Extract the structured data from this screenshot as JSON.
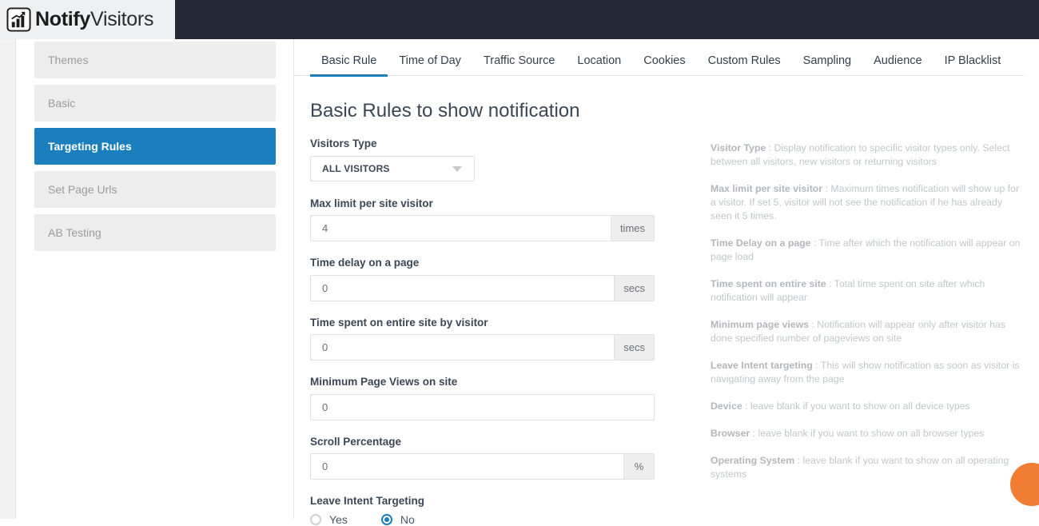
{
  "brand": {
    "logo_icon": "bar-chart-growth-icon",
    "name_bold": "Notify",
    "name_light": "Visitors"
  },
  "sidebar": {
    "items": [
      {
        "label": "Themes",
        "active": false
      },
      {
        "label": "Basic",
        "active": false
      },
      {
        "label": "Targeting Rules",
        "active": true
      },
      {
        "label": "Set Page Urls",
        "active": false
      },
      {
        "label": "AB Testing",
        "active": false
      }
    ]
  },
  "tabs": [
    {
      "label": "Basic Rule",
      "active": true
    },
    {
      "label": "Time of Day",
      "active": false
    },
    {
      "label": "Traffic Source",
      "active": false
    },
    {
      "label": "Location",
      "active": false
    },
    {
      "label": "Cookies",
      "active": false
    },
    {
      "label": "Custom Rules",
      "active": false
    },
    {
      "label": "Sampling",
      "active": false
    },
    {
      "label": "Audience",
      "active": false
    },
    {
      "label": "IP Blacklist",
      "active": false
    }
  ],
  "main": {
    "title": "Basic Rules to show notification",
    "visitors_type": {
      "label": "Visitors Type",
      "value": "ALL VISITORS",
      "caret_icon": "chevron-down-icon"
    },
    "max_limit": {
      "label": "Max limit per site visitor",
      "value": "4",
      "placeholder": "4",
      "suffix": "times"
    },
    "time_delay": {
      "label": "Time delay on a page",
      "value": "0",
      "placeholder": "0",
      "suffix": "secs"
    },
    "time_spent": {
      "label": "Time spent on entire site by visitor",
      "value": "0",
      "placeholder": "0",
      "suffix": "secs"
    },
    "min_page_views": {
      "label": "Minimum Page Views on site",
      "value": "0",
      "placeholder": "0"
    },
    "scroll_percentage": {
      "label": "Scroll Percentage",
      "value": "0",
      "placeholder": "0",
      "suffix": "%"
    },
    "leave_intent": {
      "label": "Leave Intent Targeting",
      "yes_label": "Yes",
      "no_label": "No",
      "selected": "No"
    }
  },
  "help": {
    "items": [
      {
        "term": "Visitor Type",
        "text": " : Display notification to specific visitor types only. Select between all visitors, new visitors or returning visitors"
      },
      {
        "term": "Max limit per site visitor",
        "text": " : Maximum times notification will show up for a visitor. If set 5, visitor will not see the notification if he has already seen it 5 times."
      },
      {
        "term": "Time Delay on a page",
        "text": " : Time after which the notification will appear on page load"
      },
      {
        "term": "Time spent on entire site",
        "text": " : Total time spent on site after which notification will appear"
      },
      {
        "term": "Minimum page views",
        "text": " : Notification will appear only after visitor has done specified number of pageviews on site"
      },
      {
        "term": "Leave Intent targeting",
        "text": " : This will show notification as soon as visitor is navigating away from the page"
      },
      {
        "term": "Device",
        "text": " : leave blank if you want to show on all device types"
      },
      {
        "term": "Browser",
        "text": " : leave blank if you want to show on all browser types"
      },
      {
        "term": "Operating System",
        "text": " : leave blank if you want to show on all operating systems"
      }
    ]
  },
  "widgets": {
    "chat_bubble_color": "#f07d33"
  },
  "colors": {
    "accent": "#1b7fbd",
    "topbar": "#242836",
    "sidebar_item": "#ededed",
    "chat": "#f07d33"
  }
}
